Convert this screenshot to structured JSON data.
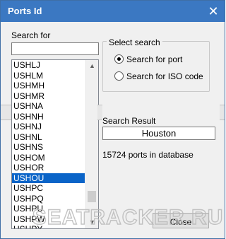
{
  "window": {
    "title": "Ports Id"
  },
  "search": {
    "label": "Search for",
    "value": ""
  },
  "ports_list": {
    "items": [
      "USHLJ",
      "USHLM",
      "USHMH",
      "USHMR",
      "USHNA",
      "USHNH",
      "USHNJ",
      "USHNL",
      "USHNS",
      "USHOM",
      "USHOR",
      "USHOU",
      "USHPC",
      "USHPQ",
      "USHPU",
      "USHPW",
      "USHPY",
      "USHQM"
    ],
    "selected": "USHOU"
  },
  "select_search": {
    "title": "Select search",
    "options": [
      {
        "label": "Search for port",
        "checked": true
      },
      {
        "label": "Search for ISO code",
        "checked": false
      }
    ]
  },
  "result": {
    "label": "Search Result",
    "value": "Houston"
  },
  "status": {
    "count_text": "15724 ports in database"
  },
  "buttons": {
    "close": "Close"
  },
  "watermark": {
    "text": "SEATRACKER.RU"
  },
  "colors": {
    "titlebar": "#3b78c2",
    "selection": "#0a64c8"
  }
}
